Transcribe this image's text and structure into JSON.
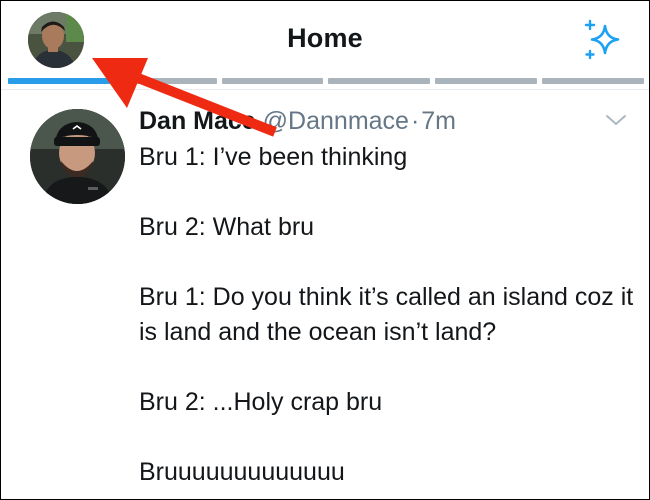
{
  "header": {
    "title": "Home",
    "profile_avatar_icon": "profile-avatar-icon",
    "sparkle_icon": "sparkle-icon",
    "accent_color": "#1da1f2",
    "segments": 6,
    "active_segment": 1
  },
  "tweet": {
    "display_name": "Dan Mace",
    "handle": "@Dannmace",
    "separator": "·",
    "time": "7m",
    "lines": [
      "Bru 1: I’ve been thinking",
      "Bru 2: What bru",
      "Bru 1: Do you think it’s called an island coz it is land and the ocean isn’t land?",
      "Bru 2: ...Holy crap bru",
      "Bruuuuuuuuuuuuu"
    ]
  },
  "annotation": {
    "arrow_color": "#ef2a12"
  }
}
